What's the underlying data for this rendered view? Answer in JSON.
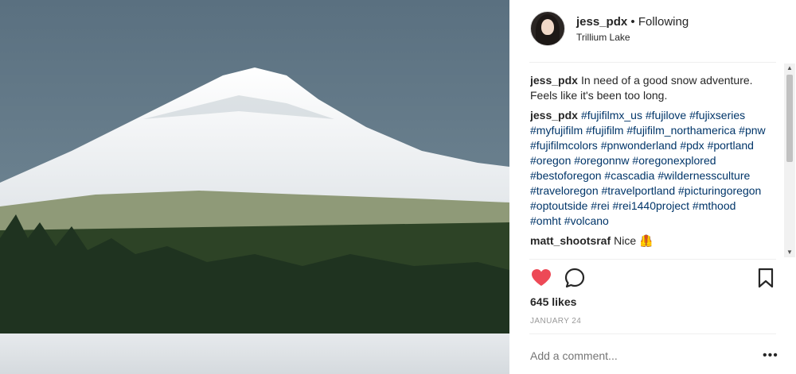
{
  "header": {
    "username": "jess_pdx",
    "separator": "•",
    "follow_status": "Following",
    "location": "Trillium Lake"
  },
  "comments": [
    {
      "author": "jess_pdx",
      "text": "In need of a good snow adventure. Feels like it's been too long."
    },
    {
      "author": "jess_pdx",
      "text": "#fujifilmx_us #fujilove #fujixseries #myfujifilm #fujifilm #fujifilm_northamerica #pnw #fujifilmcolors #pnwonderland #pdx #portland #oregon #oregonnw #oregonexplored #bestoforegon #cascadia #wildernessculture #traveloregon #travelportland #picturingoregon #optoutside #rei #rei1440project #mthood #omht #volcano"
    },
    {
      "author": "matt_shootsraf",
      "text": "Nice 🦺"
    }
  ],
  "actions": {
    "like_icon": "heart-filled-icon",
    "comment_icon": "speech-bubble-icon",
    "save_icon": "bookmark-icon",
    "like_color": "#ed4956"
  },
  "likes": "645 likes",
  "date": "JANUARY 24",
  "add_comment": {
    "placeholder": "Add a comment..."
  },
  "more_options": "•••"
}
